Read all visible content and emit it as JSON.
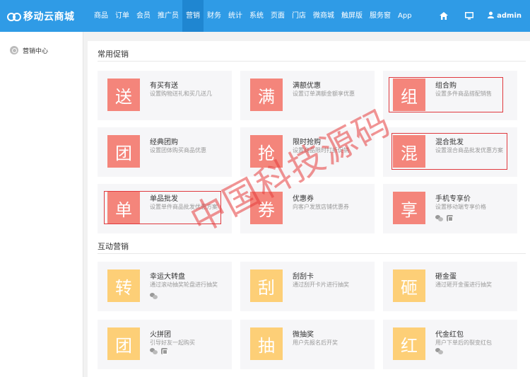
{
  "header": {
    "logo_text": "移动云商城",
    "nav": [
      "商品",
      "订单",
      "会员",
      "推广员",
      "营销",
      "财务",
      "统计",
      "系统",
      "页面",
      "门店",
      "微商城",
      "触屏版",
      "服务窗",
      "App"
    ],
    "active_nav": "营销",
    "user": "admin"
  },
  "sidebar": {
    "items": [
      {
        "label": "营销中心"
      }
    ]
  },
  "sections": {
    "common": "常用促销",
    "interactive": "互动营销"
  },
  "common_cards": [
    {
      "glyph": "送",
      "title": "有买有送",
      "desc": "设置购物送礼和买几送几",
      "color": "red"
    },
    {
      "glyph": "满",
      "title": "满额优惠",
      "desc": "设置订单满额金额享优惠",
      "color": "red"
    },
    {
      "glyph": "组",
      "title": "组合购",
      "desc": "设置多件商品搭配销售",
      "color": "red"
    },
    {
      "glyph": "团",
      "title": "经典团购",
      "desc": "设置团体购买商品优惠",
      "color": "red"
    },
    {
      "glyph": "抢",
      "title": "限时抢购",
      "desc": "设置商品限时打折促销",
      "color": "red"
    },
    {
      "glyph": "混",
      "title": "混合批发",
      "desc": "设置混合商品批发优惠方案",
      "color": "red"
    },
    {
      "glyph": "单",
      "title": "单品批发",
      "desc": "设置单件商品批发优惠方案",
      "color": "red"
    },
    {
      "glyph": "券",
      "title": "优惠券",
      "desc": "向客户发放店铺优惠券",
      "color": "red"
    },
    {
      "glyph": "享",
      "title": "手机专享价",
      "desc": "设置移动端专享价格",
      "color": "red",
      "icons": [
        "wechat-icon",
        "app-icon"
      ]
    }
  ],
  "interactive_cards": [
    {
      "glyph": "转",
      "title": "幸运大转盘",
      "desc": "通过滚动抽奖轮盘进行抽奖",
      "color": "yellow",
      "icons": [
        "wechat-icon"
      ]
    },
    {
      "glyph": "刮",
      "title": "刮刮卡",
      "desc": "通过刮开卡片进行抽奖",
      "color": "yellow"
    },
    {
      "glyph": "砸",
      "title": "砸金蛋",
      "desc": "通过砸开金蛋进行抽奖",
      "color": "yellow"
    },
    {
      "glyph": "团",
      "title": "火拼团",
      "desc": "引导好友一起购买",
      "color": "yellow",
      "icons": [
        "wechat-icon",
        "app-icon"
      ]
    },
    {
      "glyph": "抽",
      "title": "微抽奖",
      "desc": "用户先报名后开奖",
      "color": "yellow"
    },
    {
      "glyph": "红",
      "title": "代金红包",
      "desc": "用户下单后的裂变红包",
      "color": "yellow",
      "icons": [
        "wechat-icon"
      ]
    }
  ],
  "watermark": "中国科技源码",
  "colors": {
    "topbar": "#2f9be6",
    "active_nav": "#1f86d1",
    "red_glyph": "#f4857b",
    "yellow_glyph": "#fdcf77",
    "highlight": "#e0393e"
  }
}
